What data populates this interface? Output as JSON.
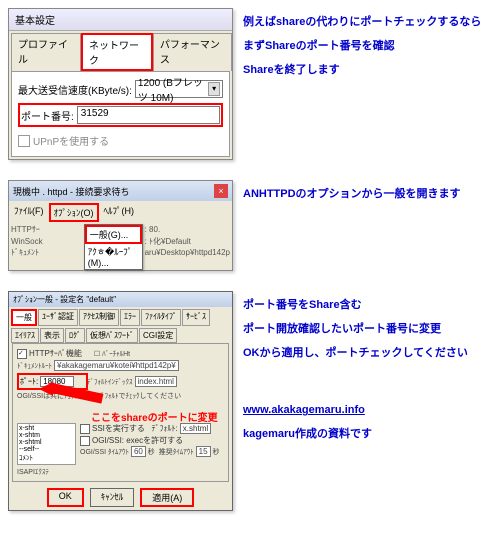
{
  "section1": {
    "title": "基本設定",
    "tabs": [
      "プロファイル",
      "ネットワーク",
      "パフォーマンス"
    ],
    "speed_label": "最大送受信速度(KByte/s):",
    "speed_value": "1200 (Bフレッツ 10M)",
    "port_label": "ポート番号:",
    "port_value": "31529",
    "upnp_label": "UPnPを使用する",
    "notes": [
      "例えばshareの代わりにポートチェックするなら",
      "まずShareのポート番号を確認",
      "Shareを終了します"
    ]
  },
  "section2": {
    "title": "現機中 . httpd - 接続要求待ち",
    "menus": [
      "ﾌｧｲﾙ(F)",
      "ｵﾌﾟｼｮﾝ(O)",
      "ﾍﾙﾌﾟ(H)"
    ],
    "dropdown": [
      "一般(G)...",
      "ｱｸﾾ�ﾙｰﾌﾟ(M)..."
    ],
    "info_lines": [
      "HTTPｻｰ",
      "WinSock",
      "ﾄﾞｷｭﾒﾝﾄ",
      ": 80.",
      ": ﾄ化¥Default",
      "aru¥Desktop¥httpd142p"
    ],
    "notes": [
      "ANHTTPDのオプションから一般を開きます"
    ]
  },
  "section3": {
    "title": "ｵﾌﾟｼｮﾝ一般 - 設定名 \"default\"",
    "tabs_row1": [
      "一般",
      "ﾕｰｻﾞ認証",
      "ｱｸｾｽ制御",
      "ｴﾗｰ",
      "ﾌｧｲﾙﾀｲﾌﾟ",
      "ｻｰﾋﾞｽ"
    ],
    "tabs_row2": [
      "ｴｲﾘｱｽ",
      "表示",
      "ﾛｸﾞ",
      "仮想ﾊﾟｽﾜｰﾄﾞ",
      "CGI設定"
    ],
    "http_label": "HTTPｻｰﾊﾞ機能",
    "port_label": "ﾎﾟｰﾄ:",
    "port_value": "18080",
    "doc_label": "ﾄﾞｷｭﾒﾝﾄﾙｰﾄ",
    "doc_value": "¥akakagemaru¥kotei¥httpd142p¥",
    "default_label": "ﾃﾞﾌｫﾙﾄｲﾝﾃﾞｯｸｽ",
    "default_value": "index.html",
    "ssi_note": "OGI/SSIは共にﾁｪｯｸｰﾋﾞｯﾄ ﾃﾞﾌｫﾙﾄでﾁｪｯｸしてください",
    "arrow_text": "ここをshareのポートに変更",
    "ext_items": [
      "x-sht",
      "x-shtm",
      "x-shtml",
      "--self--",
      "ｺﾒﾝﾄ"
    ],
    "buttons": [
      "OK",
      "ｷｬﾝｾﾙ",
      "適用(A)"
    ],
    "notes": [
      "ポート番号をShare含む",
      "ポート開放確認したいポート番号に変更",
      "OKから適用し、ポートチェックしてください"
    ],
    "link_url": "www.akakagemaru.info",
    "credit": "kagemaru作成の資料です"
  }
}
